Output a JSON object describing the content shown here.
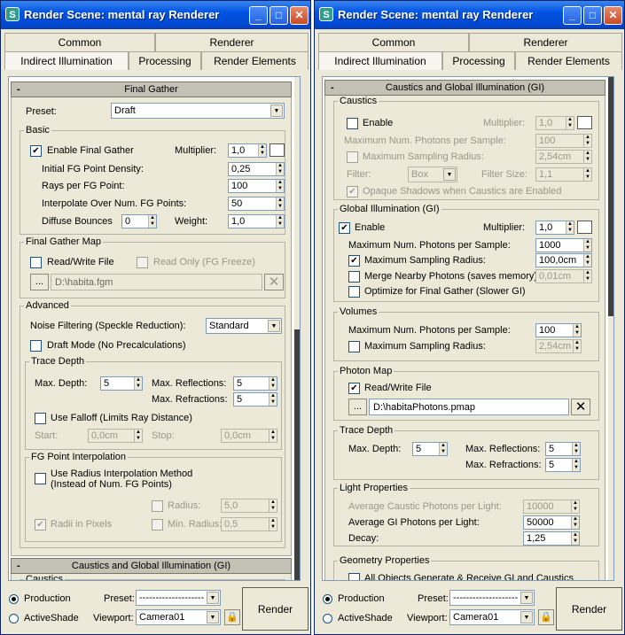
{
  "w1": {
    "title": "Render Scene: mental ray Renderer",
    "tabs_top": [
      "Common",
      "Renderer"
    ],
    "tabs_bottom": [
      "Indirect Illumination",
      "Processing",
      "Render Elements"
    ],
    "fg": {
      "minus": "-",
      "rollout_title": "Final Gather",
      "preset_label": "Preset:",
      "preset_value": "Draft",
      "basic": "Basic",
      "enable_fg": "Enable Final Gather",
      "enable_fg_check": "✔",
      "multiplier": "Multiplier:",
      "multiplier_value": "1,0",
      "density_label": "Initial FG Point Density:",
      "density": "0,25",
      "rays_label": "Rays per FG Point:",
      "rays": "100",
      "interp_label": "Interpolate Over Num. FG Points:",
      "interp": "50",
      "bounces_label": "Diffuse Bounces",
      "bounces": "0",
      "weight_label": "Weight:",
      "weight": "1,0",
      "map_group": "Final Gather Map",
      "readwrite": "Read/Write File",
      "readonly": "Read Only (FG Freeze)",
      "browse": "...",
      "path": "D:\\habita.fgm",
      "x": "✕",
      "advanced": "Advanced",
      "noise_label": "Noise Filtering (Speckle Reduction):",
      "noise_value": "Standard",
      "draft_mode": "Draft Mode (No Precalculations)",
      "trace": "Trace Depth",
      "maxdepth_label": "Max. Depth:",
      "maxdepth": "5",
      "maxrefl_label": "Max. Reflections:",
      "maxrefl": "5",
      "maxrefr_label": "Max. Refractions:",
      "maxrefr": "5",
      "falloff": "Use Falloff (Limits Ray Distance)",
      "start_label": "Start:",
      "start": "0,0cm",
      "stop_label": "Stop:",
      "stop": "0,0cm",
      "fgpi": "FG Point Interpolation",
      "radius_method_1": "Use Radius Interpolation Method",
      "radius_method_2": "(Instead of Num. FG Points)",
      "radius_label": "Radius:",
      "radius": "5,0",
      "radii_px": "Radii in Pixels",
      "radii_check": "✔",
      "minradius_label": "Min. Radius:",
      "minradius": "0,5"
    },
    "cgi_title": "Caustics and Global Illumination (GI)",
    "caustics_group": "Caustics"
  },
  "w2": {
    "title": "Render Scene: mental ray Renderer",
    "tabs_top": [
      "Common",
      "Renderer"
    ],
    "tabs_bottom": [
      "Indirect Illumination",
      "Processing",
      "Render Elements"
    ],
    "minus": "-",
    "rollout_title": "Caustics and Global Illumination (GI)",
    "caustics": {
      "group": "Caustics",
      "enable": "Enable",
      "multiplier": "Multiplier:",
      "multiplier_value": "1,0",
      "photons_label": "Maximum Num. Photons per Sample:",
      "photons": "100",
      "radius_label": "Maximum Sampling Radius:",
      "radius": "2,54cm",
      "filter_label": "Filter:",
      "filter_value": "Box",
      "filtersize_label": "Filter Size:",
      "filtersize": "1,1",
      "opaque": "Opaque Shadows when Caustics are Enabled",
      "opaque_check": "✔"
    },
    "gi": {
      "group": "Global Illumination (GI)",
      "enable": "Enable",
      "enable_check": "✔",
      "multiplier": "Multiplier:",
      "multiplier_value": "1,0",
      "photons_label": "Maximum Num. Photons per Sample:",
      "photons": "1000",
      "radius_label": "Maximum Sampling Radius:",
      "radius": "100,0cm",
      "radius_check": "✔",
      "merge_label": "Merge Nearby Photons (saves memory):",
      "merge": "0,01cm",
      "optimize": "Optimize for Final Gather (Slower GI)"
    },
    "volumes": {
      "group": "Volumes",
      "photons_label": "Maximum Num. Photons per Sample:",
      "photons": "100",
      "radius_label": "Maximum Sampling Radius:",
      "radius": "2,54cm"
    },
    "photonmap": {
      "group": "Photon Map",
      "readwrite": "Read/Write File",
      "readwrite_check": "✔",
      "browse": "...",
      "path": "D:\\habitaPhotons.pmap",
      "x": "✕"
    },
    "trace": {
      "group": "Trace Depth",
      "maxdepth_label": "Max. Depth:",
      "maxdepth": "5",
      "maxrefl_label": "Max. Reflections:",
      "maxrefl": "5",
      "maxrefr_label": "Max. Refractions:",
      "maxrefr": "5"
    },
    "light": {
      "group": "Light Properties",
      "caustic_label": "Average Caustic Photons per Light:",
      "caustic": "10000",
      "gi_label": "Average GI Photons per Light:",
      "gi": "50000",
      "decay_label": "Decay:",
      "decay": "1,25"
    },
    "geom": {
      "group": "Geometry Properties",
      "all_objects": "All Objects Generate & Receive GI and Caustics"
    }
  },
  "bottom": {
    "production": "Production",
    "activeshade": "ActiveShade",
    "preset_label": "Preset:",
    "preset_value": "--------------------",
    "viewport_label": "Viewport:",
    "viewport_value": "Camera01",
    "render": "Render",
    "lock": "🔒"
  },
  "icons": {
    "app": "3ds-max-icon",
    "minimize": "minimize-icon",
    "maximize": "maximize-icon",
    "close": "close-icon"
  }
}
